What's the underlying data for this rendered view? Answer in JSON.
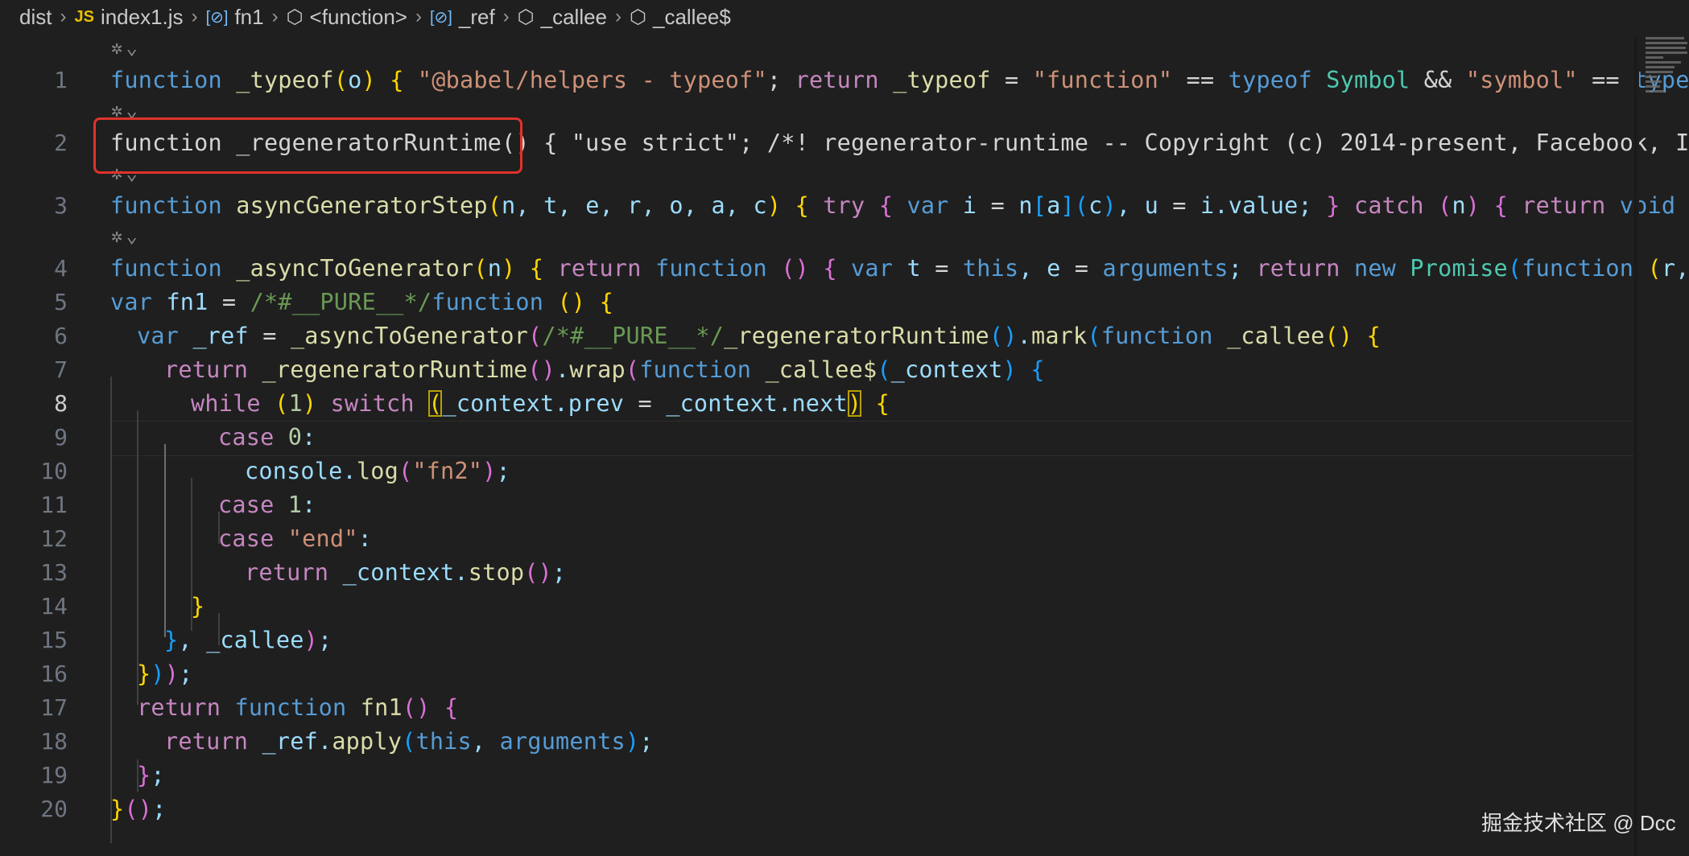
{
  "breadcrumb": {
    "items": [
      {
        "label": "dist",
        "icon": ""
      },
      {
        "label": "index1.js",
        "icon": "JS"
      },
      {
        "label": "fn1",
        "icon": "variable-icon"
      },
      {
        "label": "<function>",
        "icon": "cube-icon"
      },
      {
        "label": "_ref",
        "icon": "variable-icon"
      },
      {
        "label": "_callee",
        "icon": "cube-icon"
      },
      {
        "label": "_callee$",
        "icon": "cube-icon"
      }
    ]
  },
  "editor": {
    "active_line": 8,
    "line_numbers": [
      "1",
      "2",
      "3",
      "4",
      "5",
      "6",
      "7",
      "8",
      "9",
      "10",
      "11",
      "12",
      "13",
      "14",
      "15",
      "16",
      "17",
      "18",
      "19",
      "20"
    ],
    "highlight_color": "#e0322c"
  },
  "watermark": "掘金技术社区 @ Dcc"
}
